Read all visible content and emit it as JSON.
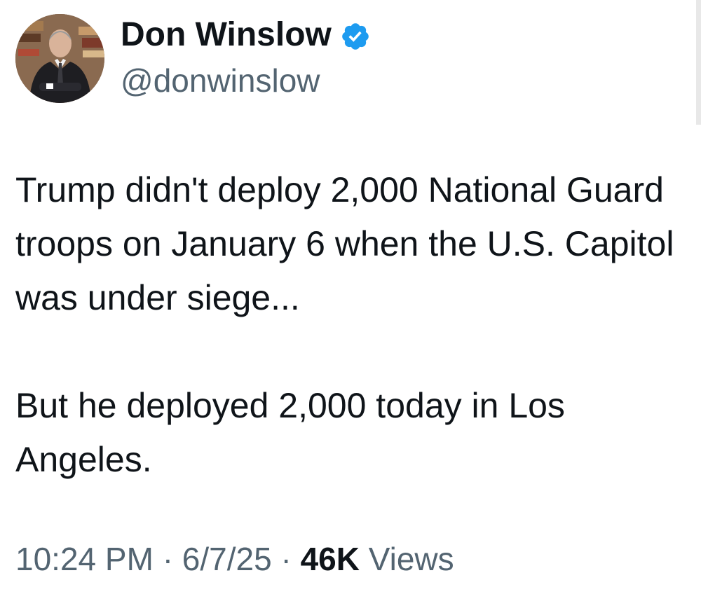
{
  "author": {
    "display_name": "Don Winslow",
    "handle": "@donwinslow",
    "verified_icon": "verified-badge-icon",
    "verified_color": "#1d9bf0"
  },
  "tweet": {
    "paragraphs": [
      "Trump didn't deploy 2,000 National Guard troops on January 6 when the U.S. Capitol was under siege...",
      "But he deployed 2,000 today in Los Angeles."
    ]
  },
  "meta": {
    "time": "10:24 PM",
    "separator": "·",
    "date": "6/7/25",
    "views_count": "46K",
    "views_label": "Views"
  },
  "colors": {
    "text": "#0f1419",
    "secondary": "#536471"
  }
}
